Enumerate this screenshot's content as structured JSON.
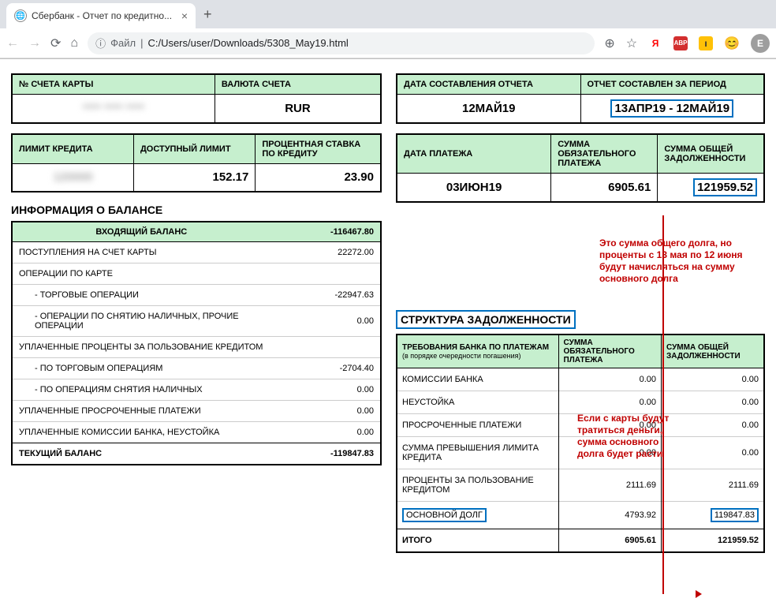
{
  "browser": {
    "tab_title": "Сбербанк - Отчет по кредитно...",
    "url_prefix": "Файл",
    "url_path": "C:/Users/user/Downloads/5308_May19.html",
    "avatar_letter": "Е"
  },
  "top_left": {
    "h_card": "№ СЧЕТА КАРТЫ",
    "h_currency": "ВАЛЮТА СЧЕТА",
    "v_card": "**** **** ****",
    "v_currency": "RUR"
  },
  "top_right": {
    "h_date": "ДАТА СОСТАВЛЕНИЯ ОТЧЕТА",
    "h_period": "ОТЧЕТ СОСТАВЛЕН ЗА ПЕРИОД",
    "v_date": "12МАЙ19",
    "v_period": "13АПР19 - 12МАЙ19"
  },
  "mid_left": {
    "h_limit": "ЛИМИТ КРЕДИТА",
    "h_avail": "ДОСТУПНЫЙ ЛИМИТ",
    "h_rate": "ПРОЦЕНТНАЯ СТАВКА ПО КРЕДИТУ",
    "v_limit": "120000",
    "v_avail": "152.17",
    "v_rate": "23.90"
  },
  "mid_right": {
    "h_paydate": "ДАТА ПЛАТЕЖА",
    "h_mand": "СУММА ОБЯЗАТЕЛЬНОГО ПЛАТЕЖА",
    "h_total": "СУММА ОБЩЕЙ ЗАДОЛЖЕННОСТИ",
    "v_paydate": "03ИЮН19",
    "v_mand": "6905.61",
    "v_total": "121959.52"
  },
  "balance": {
    "title": "ИНФОРМАЦИЯ О БАЛАНСЕ",
    "h_in": "ВХОДЯЩИЙ БАЛАНС",
    "v_in": "-116467.80",
    "rows": [
      {
        "label": "ПОСТУПЛЕНИЯ НА СЧЕТ КАРТЫ",
        "val": "22272.00",
        "indent": false
      },
      {
        "label": "ОПЕРАЦИИ ПО КАРТЕ",
        "val": "",
        "indent": false
      },
      {
        "label": "- ТОРГОВЫЕ ОПЕРАЦИИ",
        "val": "-22947.63",
        "indent": true
      },
      {
        "label": "- ОПЕРАЦИИ ПО СНЯТИЮ НАЛИЧНЫХ, ПРОЧИЕ ОПЕРАЦИИ",
        "val": "0.00",
        "indent": true
      },
      {
        "label": "УПЛАЧЕННЫЕ ПРОЦЕНТЫ ЗА ПОЛЬЗОВАНИЕ КРЕДИТОМ",
        "val": "",
        "indent": false
      },
      {
        "label": "- ПО ТОРГОВЫМ ОПЕРАЦИЯМ",
        "val": "-2704.40",
        "indent": true
      },
      {
        "label": "- ПО ОПЕРАЦИЯМ СНЯТИЯ НАЛИЧНЫХ",
        "val": "0.00",
        "indent": true
      },
      {
        "label": "УПЛАЧЕННЫЕ ПРОСРОЧЕННЫЕ ПЛАТЕЖИ",
        "val": "0.00",
        "indent": false
      },
      {
        "label": "УПЛАЧЕННЫЕ КОМИССИИ БАНКА, НЕУСТОЙКА",
        "val": "0.00",
        "indent": false
      }
    ],
    "h_out": "ТЕКУЩИЙ БАЛАНС",
    "v_out": "-119847.83"
  },
  "debt": {
    "title": "СТРУКТУРА ЗАДОЛЖЕННОСТИ",
    "h_req": "ТРЕБОВАНИЯ БАНКА ПО ПЛАТЕЖАМ",
    "h_req_sub": "(в порядке очередности погашения)",
    "h_mand": "СУММА ОБЯЗАТЕЛЬНОГО ПЛАТЕЖА",
    "h_total": "СУММА ОБЩЕЙ ЗАДОЛЖЕННОСТИ",
    "rows": [
      {
        "label": "КОМИССИИ БАНКА",
        "mand": "0.00",
        "total": "0.00"
      },
      {
        "label": "НЕУСТОЙКА",
        "mand": "0.00",
        "total": "0.00"
      },
      {
        "label": "ПРОСРОЧЕННЫЕ ПЛАТЕЖИ",
        "mand": "0.00",
        "total": "0.00"
      },
      {
        "label": "СУММА ПРЕВЫШЕНИЯ ЛИМИТА КРЕДИТА",
        "mand": "0.00",
        "total": "0.00"
      },
      {
        "label": "ПРОЦЕНТЫ ЗА ПОЛЬЗОВАНИЕ КРЕДИТОМ",
        "mand": "2111.69",
        "total": "2111.69"
      },
      {
        "label": "ОСНОВНОЙ ДОЛГ",
        "mand": "4793.92",
        "total": "119847.83"
      }
    ],
    "total_label": "ИТОГО",
    "total_mand": "6905.61",
    "total_total": "121959.52"
  },
  "annotations": {
    "a1": "Это сумма общего долга, но проценты с 13 мая по 12 июня будут начисляться на сумму основного долга",
    "a2": "Если с карты будут тратиться деньги, сумма основного долга будет расти"
  }
}
